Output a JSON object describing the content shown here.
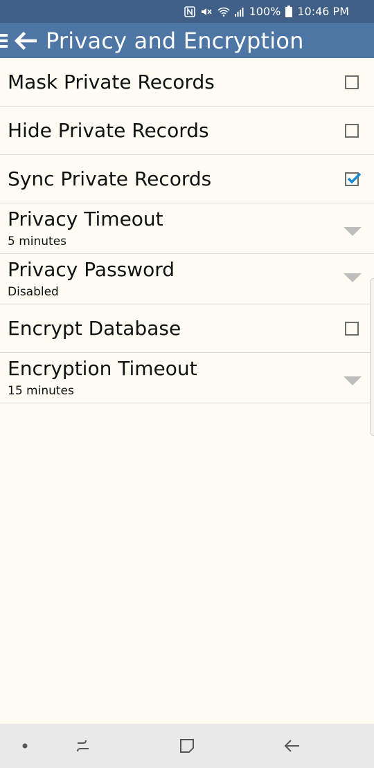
{
  "status_bar": {
    "battery": "100%",
    "time": "10:46 PM",
    "icons": [
      "nfc-icon",
      "mute-icon",
      "wifi-icon",
      "signal-icon",
      "battery-icon"
    ]
  },
  "app_bar": {
    "title": "Privacy and Encryption",
    "background": "#4d76a5",
    "icons": [
      "menu-icon",
      "back-arrow-icon"
    ]
  },
  "settings": [
    {
      "label": "Mask Private Records",
      "control": "checkbox",
      "checked": false
    },
    {
      "label": "Hide Private Records",
      "control": "checkbox",
      "checked": false
    },
    {
      "label": "Sync Private Records",
      "control": "checkbox",
      "checked": true
    },
    {
      "label": "Privacy Timeout",
      "value": "5 minutes",
      "control": "dropdown"
    },
    {
      "label": "Privacy Password",
      "value": "Disabled",
      "control": "dropdown"
    },
    {
      "label": "Encrypt Database",
      "control": "checkbox",
      "checked": false
    },
    {
      "label": "Encryption Timeout",
      "value": "15 minutes",
      "control": "dropdown"
    }
  ],
  "colors": {
    "accent_check": "#1a8bd1",
    "background": "#fcfcf3",
    "status_bar": "#3f5f86"
  },
  "nav_bar": {
    "buttons": [
      "dot-icon",
      "recent-apps-icon",
      "home-icon",
      "back-icon"
    ]
  }
}
